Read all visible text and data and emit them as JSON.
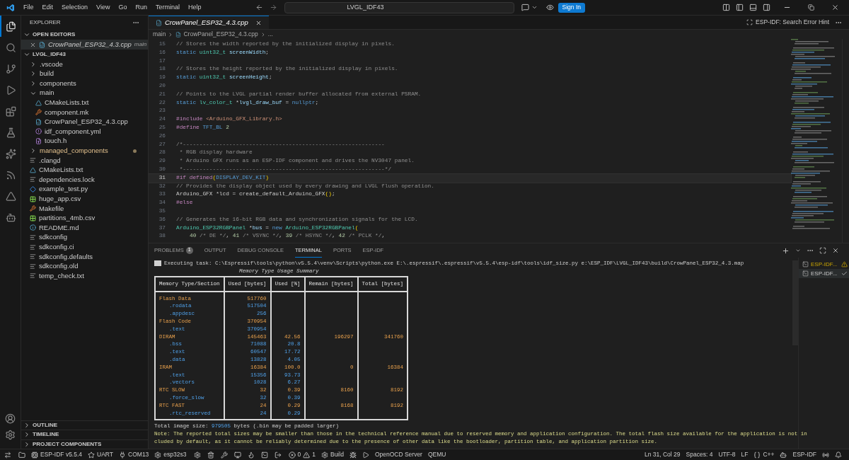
{
  "title_bar": {
    "menus": [
      "File",
      "Edit",
      "Selection",
      "View",
      "Go",
      "Run",
      "Terminal",
      "Help"
    ],
    "search": {
      "value": "LVGL_IDF43"
    },
    "sign_in": "Sign In"
  },
  "activity_bar": [
    {
      "selected": true
    },
    {
      "selected": false
    },
    {
      "selected": false
    },
    {
      "selected": false
    },
    {
      "selected": false
    },
    {
      "selected": false
    },
    {
      "selected": false
    },
    {
      "selected": false
    },
    {
      "selected": false
    },
    {
      "selected": false
    }
  ],
  "sidebar": {
    "title": "EXPLORER",
    "open_editors": {
      "title": "OPEN EDITORS",
      "items": [
        {
          "name": "CrowPanel_ESP32_4.3.cpp",
          "path": "main",
          "kind": "cpp"
        }
      ]
    },
    "root": {
      "name": "LVGL_IDF43",
      "expanded": true,
      "children": [
        {
          "name": ".vscode",
          "kind": "folder",
          "expanded": false,
          "modified": false
        },
        {
          "name": "build",
          "kind": "folder",
          "expanded": false,
          "modified": false
        },
        {
          "name": "components",
          "kind": "folder",
          "expanded": false,
          "modified": false
        },
        {
          "name": "main",
          "kind": "folder",
          "expanded": true,
          "modified": false,
          "children": [
            {
              "name": "CMakeLists.txt",
              "kind": "cmake",
              "modified": false
            },
            {
              "name": "component.mk",
              "kind": "make",
              "modified": false
            },
            {
              "name": "CrowPanel_ESP32_4.3.cpp",
              "kind": "cpp",
              "modified": false
            },
            {
              "name": "idf_component.yml",
              "kind": "yaml",
              "modified": false
            },
            {
              "name": "touch.h",
              "kind": "header",
              "modified": false
            }
          ]
        },
        {
          "name": "managed_components",
          "kind": "folder",
          "expanded": false,
          "modified": true
        },
        {
          "name": ".clangd",
          "kind": "lines",
          "modified": false
        },
        {
          "name": "CMakeLists.txt",
          "kind": "cmake",
          "modified": false
        },
        {
          "name": "dependencies.lock",
          "kind": "lines",
          "modified": false
        },
        {
          "name": "example_test.py",
          "kind": "python",
          "modified": false
        },
        {
          "name": "huge_app.csv",
          "kind": "csv",
          "modified": false
        },
        {
          "name": "Makefile",
          "kind": "make",
          "modified": false
        },
        {
          "name": "partitions_4mb.csv",
          "kind": "csv",
          "modified": false
        },
        {
          "name": "README.md",
          "kind": "info",
          "modified": false
        },
        {
          "name": "sdkconfig",
          "kind": "lines",
          "modified": false
        },
        {
          "name": "sdkconfig.ci",
          "kind": "lines",
          "modified": false
        },
        {
          "name": "sdkconfig.defaults",
          "kind": "lines",
          "modified": false
        },
        {
          "name": "sdkconfig.old",
          "kind": "lines",
          "modified": false
        },
        {
          "name": "temp_check.txt",
          "kind": "lines",
          "modified": false
        }
      ]
    },
    "sections": [
      "OUTLINE",
      "TIMELINE",
      "PROJECT COMPONENTS"
    ]
  },
  "editor": {
    "tabs": [
      {
        "label": "CrowPanel_ESP32_4.3.cpp",
        "selected": true
      }
    ],
    "action": "ESP-IDF: Search Error Hint",
    "breadcrumb": [
      "main",
      "CrowPanel_ESP32_4.3.cpp",
      "..."
    ],
    "lines": [
      {
        "number": "15",
        "current": false,
        "tokens": [
          {
            "kind": "comment",
            "text": "// Stores the width reported by the initialized display in pixels."
          }
        ]
      },
      {
        "number": "16",
        "current": false,
        "tokens": [
          {
            "kind": "keyword",
            "text": "static "
          },
          {
            "kind": "type",
            "text": "uint32_t "
          },
          {
            "kind": "variable",
            "text": "screenWidth"
          },
          {
            "kind": "plain",
            "text": ";"
          }
        ]
      },
      {
        "number": "17",
        "current": false
      },
      {
        "number": "18",
        "current": false,
        "tokens": [
          {
            "kind": "comment",
            "text": "// Stores the height reported by the initialized display in pixels."
          }
        ]
      },
      {
        "number": "19",
        "current": false,
        "tokens": [
          {
            "kind": "keyword",
            "text": "static "
          },
          {
            "kind": "type",
            "text": "uint32_t "
          },
          {
            "kind": "variable",
            "text": "screenHeight"
          },
          {
            "kind": "plain",
            "text": ";"
          }
        ]
      },
      {
        "number": "20",
        "current": false
      },
      {
        "number": "21",
        "current": false,
        "tokens": [
          {
            "kind": "comment",
            "text": "// Points to the LVGL partial render buffer allocated from external PSRAM."
          }
        ]
      },
      {
        "number": "22",
        "current": false,
        "tokens": [
          {
            "kind": "keyword",
            "text": "static "
          },
          {
            "kind": "type",
            "text": "lv_color_t "
          },
          {
            "kind": "plain",
            "text": "*"
          },
          {
            "kind": "variable",
            "text": "lvgl_draw_buf"
          },
          {
            "kind": "plain",
            "text": " = "
          },
          {
            "kind": "keyword",
            "text": "nullptr"
          },
          {
            "kind": "plain",
            "text": ";"
          }
        ]
      },
      {
        "number": "23",
        "current": false
      },
      {
        "number": "24",
        "current": false,
        "tokens": [
          {
            "kind": "preproc",
            "text": "#include "
          },
          {
            "kind": "string",
            "text": "<Arduino_GFX_Library.h>"
          }
        ]
      },
      {
        "number": "25",
        "current": false,
        "tokens": [
          {
            "kind": "preproc",
            "text": "#define "
          },
          {
            "kind": "macro",
            "text": "TFT_BL "
          },
          {
            "kind": "number",
            "text": "2"
          }
        ]
      },
      {
        "number": "26",
        "current": false
      },
      {
        "number": "27",
        "current": false,
        "tokens": [
          {
            "kind": "comment",
            "text": "/*-------------------------------------------------------------"
          }
        ]
      },
      {
        "number": "28",
        "current": false,
        "tokens": [
          {
            "kind": "comment",
            "text": " * RGB display hardware"
          }
        ]
      },
      {
        "number": "29",
        "current": false,
        "tokens": [
          {
            "kind": "comment",
            "text": " * Arduino GFX runs as an ESP-IDF component and drives the NV3047 panel."
          }
        ]
      },
      {
        "number": "30",
        "current": false,
        "tokens": [
          {
            "kind": "comment",
            "text": " *-------------------------------------------------------------*/"
          }
        ]
      },
      {
        "number": "31",
        "current": true,
        "tokens": [
          {
            "kind": "preproc",
            "text": "#if defined"
          },
          {
            "kind": "paren",
            "text": "("
          },
          {
            "kind": "macro",
            "text": "DISPLAY_DEV_KIT"
          },
          {
            "kind": "paren",
            "text": ")"
          }
        ]
      },
      {
        "number": "32",
        "current": false,
        "tokens": [
          {
            "kind": "comment",
            "text": "// Provides the display object used by every drawing and LVGL flush operation."
          }
        ]
      },
      {
        "number": "33",
        "current": false,
        "tokens": [
          {
            "kind": "plain",
            "text": "Arduino_GFX *lcd = create_default_Arduino_GFX"
          },
          {
            "kind": "paren",
            "text": "()"
          },
          {
            "kind": "plain",
            "text": ";"
          }
        ]
      },
      {
        "number": "34",
        "current": false,
        "tokens": [
          {
            "kind": "preproc",
            "text": "#else"
          }
        ]
      },
      {
        "number": "35",
        "current": false
      },
      {
        "number": "36",
        "current": false,
        "tokens": [
          {
            "kind": "comment",
            "text": "// Generates the 16-bit RGB data and synchronization signals for the LCD."
          }
        ]
      },
      {
        "number": "37",
        "current": false,
        "tokens": [
          {
            "kind": "type",
            "text": "Arduino_ESP32RGBPanel "
          },
          {
            "kind": "plain",
            "text": "*"
          },
          {
            "kind": "variable",
            "text": "bus"
          },
          {
            "kind": "plain",
            "text": " = "
          },
          {
            "kind": "keyword",
            "text": "new "
          },
          {
            "kind": "type",
            "text": "Arduino_ESP32RGBPanel"
          },
          {
            "kind": "paren",
            "text": "("
          }
        ]
      },
      {
        "number": "38",
        "current": false,
        "indent": true,
        "tokens": [
          {
            "kind": "number",
            "text": "40"
          },
          {
            "kind": "comment",
            "text": " /* DE */"
          },
          {
            "kind": "plain",
            "text": ", "
          },
          {
            "kind": "number",
            "text": "41"
          },
          {
            "kind": "comment",
            "text": " /* VSYNC */"
          },
          {
            "kind": "plain",
            "text": ", "
          },
          {
            "kind": "number",
            "text": "39"
          },
          {
            "kind": "comment",
            "text": " /* HSYNC */"
          },
          {
            "kind": "plain",
            "text": ", "
          },
          {
            "kind": "number",
            "text": "42"
          },
          {
            "kind": "comment",
            "text": " /* PCLK */"
          },
          {
            "kind": "plain",
            "text": ","
          }
        ]
      }
    ]
  },
  "panel": {
    "tabs": [
      {
        "label": "PROBLEMS",
        "badge": "1",
        "selected": false
      },
      {
        "label": "OUTPUT",
        "selected": false
      },
      {
        "label": "DEBUG CONSOLE",
        "selected": false
      },
      {
        "label": "TERMINAL",
        "selected": true
      },
      {
        "label": "PORTS",
        "selected": false
      },
      {
        "label": "ESP-IDF",
        "selected": false
      }
    ],
    "task": "Executing task: C:\\Espressif\\tools\\python\\v5.5.4\\venv\\Scripts\\python.exe E:\\.espressif\\.espressif\\v5.5.4\\esp-idf\\tools\\idf_size.py e:\\ESP_IDF\\LVGL_IDF43\\build\\CrowPanel_ESP32_4.3.map",
    "summary_title": "Memory Type Usage Summary",
    "table": {
      "columns": [
        "Memory Type/Section",
        "Used [bytes]",
        "Used [%]",
        "Remain [bytes]",
        "Total [bytes]"
      ],
      "rows": [
        {
          "kind": "section",
          "cells": [
            "Flash Data",
            "517760",
            "",
            "",
            ""
          ]
        },
        {
          "kind": "sub",
          "cells": [
            ".rodata",
            "517504",
            "",
            "",
            ""
          ]
        },
        {
          "kind": "sub",
          "cells": [
            ".appdesc",
            "256",
            "",
            "",
            ""
          ]
        },
        {
          "kind": "section",
          "cells": [
            "Flash Code",
            "370954",
            "",
            "",
            ""
          ]
        },
        {
          "kind": "sub",
          "cells": [
            ".text",
            "370954",
            "",
            "",
            ""
          ]
        },
        {
          "kind": "section",
          "cells": [
            "DIRAM",
            "145463",
            "42.56",
            "196297",
            "341760"
          ]
        },
        {
          "kind": "sub",
          "cells": [
            ".bss",
            "71088",
            "20.8",
            "",
            ""
          ]
        },
        {
          "kind": "sub",
          "cells": [
            ".text",
            "60547",
            "17.72",
            "",
            ""
          ]
        },
        {
          "kind": "sub",
          "cells": [
            ".data",
            "13828",
            "4.05",
            "",
            ""
          ]
        },
        {
          "kind": "section",
          "cells": [
            "IRAM",
            "16384",
            "100.0",
            "0",
            "16384"
          ]
        },
        {
          "kind": "sub",
          "cells": [
            ".text",
            "15356",
            "93.73",
            "",
            ""
          ]
        },
        {
          "kind": "sub",
          "cells": [
            ".vectors",
            "1028",
            "6.27",
            "",
            ""
          ]
        },
        {
          "kind": "section",
          "cells": [
            "RTC SLOW",
            "32",
            "0.39",
            "8160",
            "8192"
          ]
        },
        {
          "kind": "sub",
          "cells": [
            ".force_slow",
            "32",
            "0.39",
            "",
            ""
          ]
        },
        {
          "kind": "section",
          "cells": [
            "RTC FAST",
            "24",
            "0.29",
            "8168",
            "8192"
          ]
        },
        {
          "kind": "sub",
          "cells": [
            ".rtc_reserved",
            "24",
            "0.29",
            "",
            ""
          ]
        }
      ]
    },
    "total": {
      "before": "Total image size: ",
      "value": "979505",
      "after": " bytes (.bin may be padded larger)"
    },
    "note": [
      "Note: The reported total sizes may be smaller than those in the technical reference manual due to reserved memory and application configuration. The total flash size available for the application is not in",
      "cluded by default, as it cannot be reliably determined due to the presence of other data like the bootloader, partition table, and application partition size."
    ],
    "terminals": [
      {
        "label": "ESP-IDF...",
        "kind": "warning",
        "selected": false
      },
      {
        "label": "ESP-IDF...",
        "kind": "done",
        "selected": true
      }
    ]
  },
  "status_bar": {
    "left": [
      {
        "kind": "remote"
      },
      {
        "kind": "folder"
      },
      {
        "kind": "board",
        "text": "ESP-IDF v5.5.4"
      },
      {
        "kind": "serial",
        "text": "UART"
      },
      {
        "kind": "port",
        "text": "COM13"
      },
      {
        "kind": "target",
        "text": "esp32s3"
      },
      {
        "kind": "tools"
      },
      {
        "kind": "problems",
        "errors": "0",
        "warnings": "1"
      },
      {
        "kind": "build",
        "text": "Build"
      },
      {
        "kind": "debug"
      },
      {
        "kind": "run"
      },
      {
        "kind": "plain",
        "text": "OpenOCD Server"
      },
      {
        "kind": "plain",
        "text": "QEMU"
      }
    ],
    "right": [
      {
        "kind": "plain",
        "text": "Ln 31, Col 29"
      },
      {
        "kind": "plain",
        "text": "Spaces: 4"
      },
      {
        "kind": "plain",
        "text": "UTF-8"
      },
      {
        "kind": "plain",
        "text": "LF"
      },
      {
        "kind": "language",
        "text": "C++"
      },
      {
        "kind": "copilot"
      },
      {
        "kind": "plain",
        "text": "ESP-IDF"
      },
      {
        "kind": "broadcast"
      },
      {
        "kind": "bell"
      }
    ]
  }
}
